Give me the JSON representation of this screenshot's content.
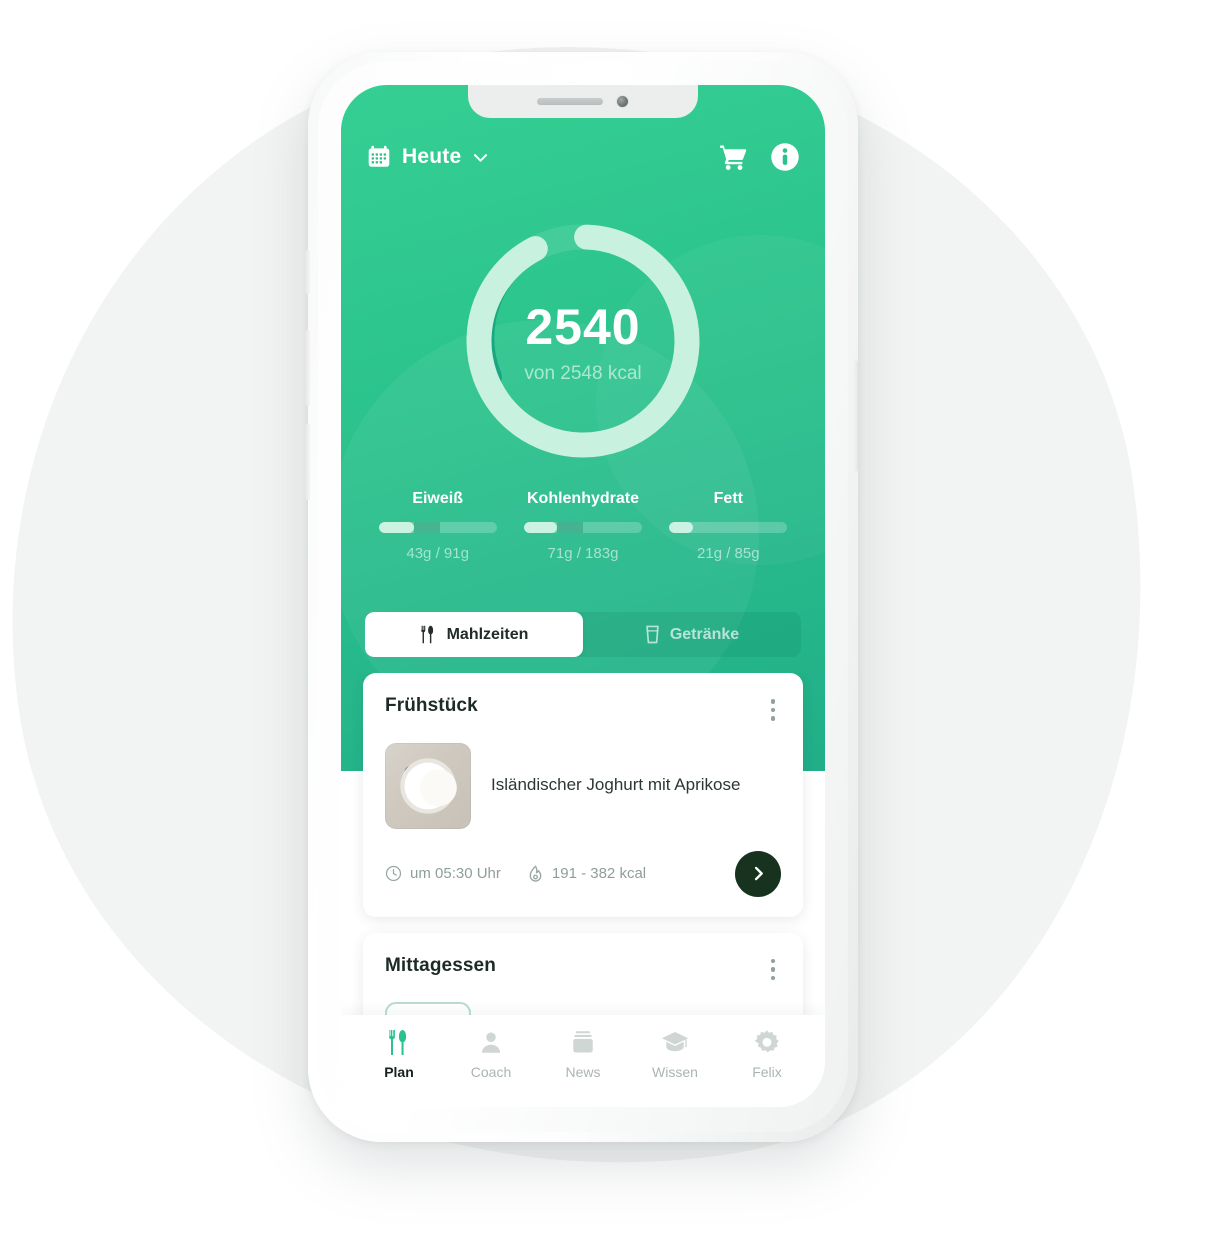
{
  "header": {
    "calendar_icon": "calendar-icon",
    "date_label": "Heute",
    "chevron_icon": "chevron-down-icon",
    "cart_icon": "cart-icon",
    "info_icon": "info-icon"
  },
  "calories": {
    "value": "2540",
    "subtitle": "von 2548 kcal",
    "consumed": 2540,
    "goal": 2548,
    "progress_pct": 99.7,
    "ring_color": "#c9f1e0",
    "ring_track_color": "#1aa77f",
    "background_color": "#2bc28d"
  },
  "macros": [
    {
      "name": "Eiweiß",
      "value": "43g / 91g",
      "current_g": 43,
      "goal_g": 91,
      "fill_pct": 30,
      "mid_pct": 22
    },
    {
      "name": "Kohlenhydrate",
      "value": "71g / 183g",
      "current_g": 71,
      "goal_g": 183,
      "fill_pct": 28,
      "mid_pct": 22
    },
    {
      "name": "Fett",
      "value": "21g / 85g",
      "current_g": 21,
      "goal_g": 85,
      "fill_pct": 20,
      "mid_pct": 0
    }
  ],
  "tabs": [
    {
      "label": "Mahlzeiten",
      "icon": "cutlery-icon",
      "active": true
    },
    {
      "label": "Getränke",
      "icon": "glass-icon",
      "active": false
    }
  ],
  "meals": [
    {
      "title": "Frühstück",
      "menu_icon": "kebab-menu-icon",
      "item_name": "Isländischer Joghurt mit Aprikose",
      "thumbnail_alt": "yogurt-bowl-photo",
      "time_icon": "clock-icon",
      "time": "um 05:30 Uhr",
      "kcal_icon": "flame-icon",
      "kcal": "191 - 382 kcal",
      "go_icon": "chevron-right-icon"
    },
    {
      "title": "Mittagessen",
      "menu_icon": "kebab-menu-icon",
      "placeholder_icon": "skip-forward-icon"
    }
  ],
  "bottom_nav": [
    {
      "label": "Plan",
      "icon": "cutlery-icon",
      "active": true
    },
    {
      "label": "Coach",
      "icon": "person-icon",
      "active": false
    },
    {
      "label": "News",
      "icon": "newspaper-icon",
      "active": false
    },
    {
      "label": "Wissen",
      "icon": "graduation-cap-icon",
      "active": false
    },
    {
      "label": "Felix",
      "icon": "gear-icon",
      "active": false
    }
  ],
  "colors": {
    "accent_green": "#2bc28d",
    "nav_active": "#2bc28d",
    "dark_button": "#17331f",
    "muted_text": "#8e9e98",
    "page_background": "#f2f3f3"
  }
}
